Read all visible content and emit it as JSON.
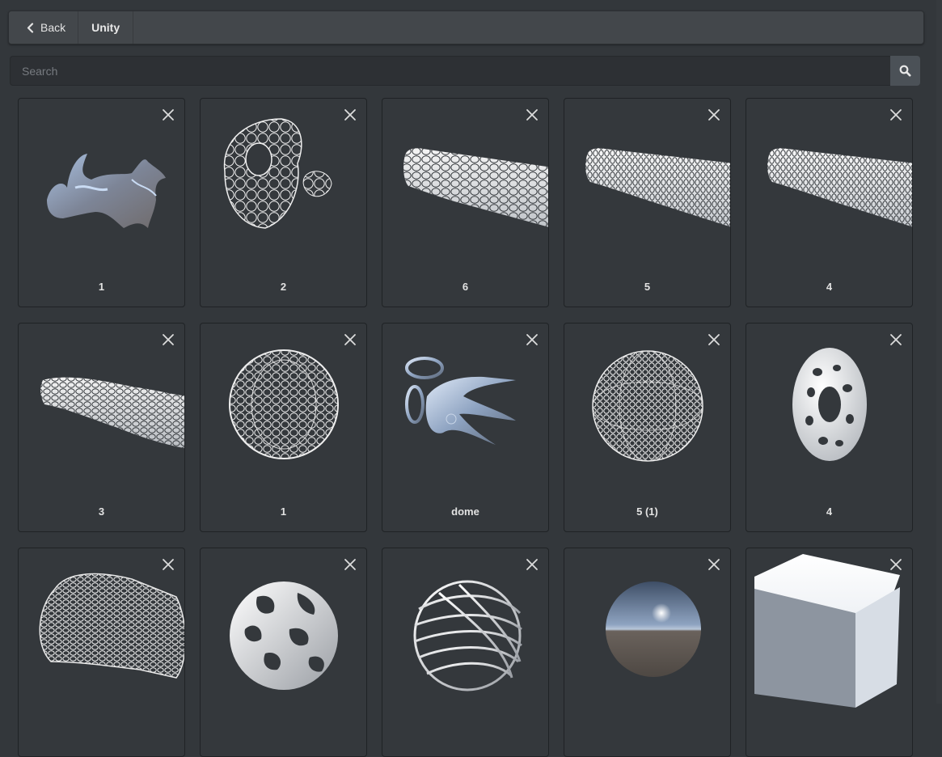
{
  "header": {
    "back_label": "Back",
    "breadcrumb": "Unity"
  },
  "search": {
    "placeholder": "Search",
    "value": ""
  },
  "items": [
    {
      "label": "1",
      "thumb": "organic-blob"
    },
    {
      "label": "2",
      "thumb": "voronoi-shell"
    },
    {
      "label": "6",
      "thumb": "lattice-tube"
    },
    {
      "label": "5",
      "thumb": "lattice-tube-fine"
    },
    {
      "label": "4",
      "thumb": "lattice-tube-fine"
    },
    {
      "label": "3",
      "thumb": "voronoi-tube"
    },
    {
      "label": "1",
      "thumb": "voronoi-sphere"
    },
    {
      "label": "dome",
      "thumb": "chrome-sculpture"
    },
    {
      "label": "5 (1)",
      "thumb": "voronoi-sphere-fine"
    },
    {
      "label": "4",
      "thumb": "gyroid-torus"
    },
    {
      "label": "",
      "thumb": "hex-cylinder"
    },
    {
      "label": "",
      "thumb": "gyroid-sphere"
    },
    {
      "label": "",
      "thumb": "ribbon-sphere"
    },
    {
      "label": "",
      "thumb": "chrome-sphere"
    },
    {
      "label": "",
      "thumb": "white-cube"
    }
  ],
  "icons": {
    "back": "chevron-left-icon",
    "search": "search-icon",
    "close": "close-icon"
  }
}
